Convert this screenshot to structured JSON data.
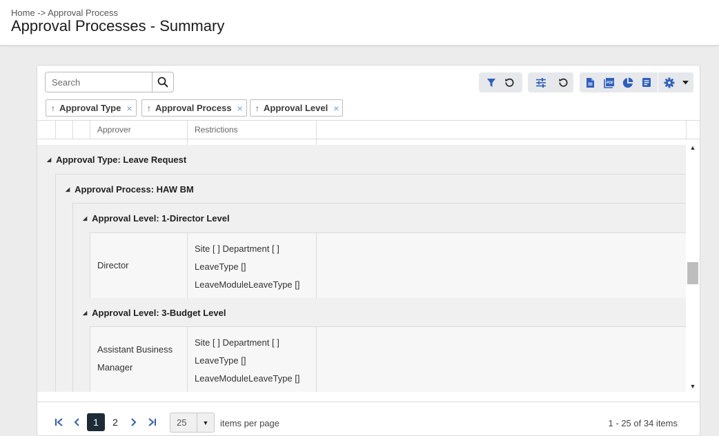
{
  "header": {
    "breadcrumb": "Home -> Approval Process",
    "title": "Approval Processes - Summary"
  },
  "search": {
    "placeholder": "Search",
    "value": ""
  },
  "toolbar": {
    "icons": [
      "filter-icon",
      "reset-icon",
      "columns-settings-icon",
      "reset-icon",
      "document-icon",
      "pdf-icon",
      "pie-chart-icon",
      "report-icon",
      "gear-icon",
      "caret-down-icon"
    ],
    "accent": "#2d5fbf"
  },
  "chips": [
    {
      "arrow": "↑",
      "label": "Approval Type",
      "close": "×"
    },
    {
      "arrow": "↑",
      "label": "Approval Process",
      "close": "×"
    },
    {
      "arrow": "↑",
      "label": "Approval Level",
      "close": "×"
    }
  ],
  "columns": {
    "approver": "Approver",
    "restrictions": "Restrictions"
  },
  "groups": {
    "type": "Approval Type: Leave Request",
    "process": "Approval Process: HAW BM",
    "levels": [
      {
        "label": "Approval Level: 1-Director Level"
      },
      {
        "label": "Approval Level: 3-Budget Level"
      }
    ]
  },
  "rows": [
    {
      "approver": "Director",
      "restrictions": [
        "Site [ ] Department [ ]",
        "LeaveType []",
        "LeaveModuleLeaveType []"
      ]
    },
    {
      "approver": "Assistant Business Manager",
      "restrictions": [
        "Site [ ] Department [ ]",
        "LeaveType []",
        "LeaveModuleLeaveType []"
      ]
    }
  ],
  "pager": {
    "pages": [
      "1",
      "2"
    ],
    "current": "1",
    "page_size": "25",
    "per_page_label": "items per page",
    "info": "1 - 25 of 34 items"
  }
}
